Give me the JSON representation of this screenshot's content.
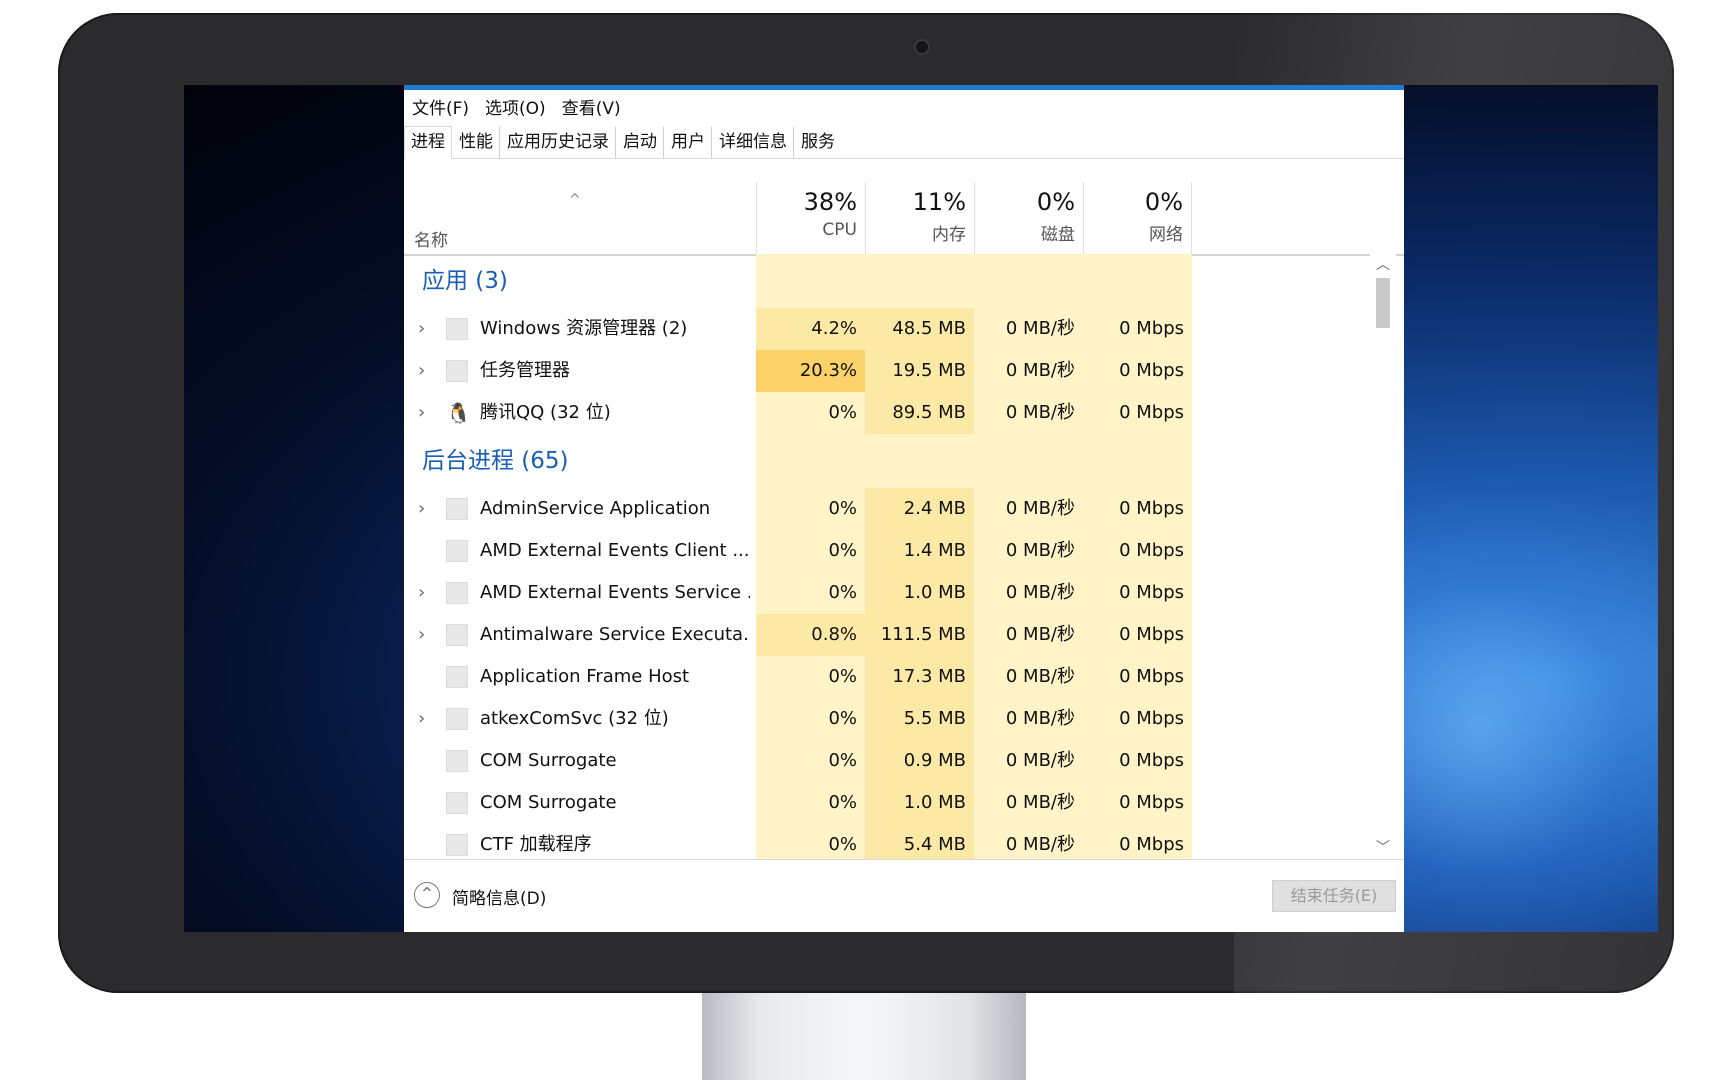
{
  "menu": [
    "文件(F)",
    "选项(O)",
    "查看(V)"
  ],
  "tabs": [
    "进程",
    "性能",
    "应用历史记录",
    "启动",
    "用户",
    "详细信息",
    "服务"
  ],
  "header": {
    "name": "名称",
    "columns": [
      {
        "pct": "38%",
        "label": "CPU"
      },
      {
        "pct": "11%",
        "label": "内存"
      },
      {
        "pct": "0%",
        "label": "磁盘"
      },
      {
        "pct": "0%",
        "label": "网络"
      }
    ]
  },
  "groups": {
    "apps": "应用 (3)",
    "background": "后台进程 (65)"
  },
  "apps": [
    {
      "name": "Windows 资源管理器 (2)",
      "cpu": "4.2%",
      "mem": "48.5 MB",
      "disk": "0 MB/秒",
      "net": "0 Mbps",
      "expand": true,
      "icon": "folder-icon"
    },
    {
      "name": "任务管理器",
      "cpu": "20.3%",
      "mem": "19.5 MB",
      "disk": "0 MB/秒",
      "net": "0 Mbps",
      "expand": true,
      "icon": "taskmgr-icon"
    },
    {
      "name": "腾讯QQ (32 位)",
      "cpu": "0%",
      "mem": "89.5 MB",
      "disk": "0 MB/秒",
      "net": "0 Mbps",
      "expand": true,
      "icon": "qq-penguin-icon"
    }
  ],
  "background": [
    {
      "name": "AdminService Application",
      "cpu": "0%",
      "mem": "2.4 MB",
      "disk": "0 MB/秒",
      "net": "0 Mbps",
      "expand": true
    },
    {
      "name": "AMD External Events Client ...",
      "cpu": "0%",
      "mem": "1.4 MB",
      "disk": "0 MB/秒",
      "net": "0 Mbps",
      "expand": false
    },
    {
      "name": "AMD External Events Service ...",
      "cpu": "0%",
      "mem": "1.0 MB",
      "disk": "0 MB/秒",
      "net": "0 Mbps",
      "expand": true
    },
    {
      "name": "Antimalware Service Executa...",
      "cpu": "0.8%",
      "mem": "111.5 MB",
      "disk": "0 MB/秒",
      "net": "0 Mbps",
      "expand": true
    },
    {
      "name": "Application Frame Host",
      "cpu": "0%",
      "mem": "17.3 MB",
      "disk": "0 MB/秒",
      "net": "0 Mbps",
      "expand": false
    },
    {
      "name": "atkexComSvc (32 位)",
      "cpu": "0%",
      "mem": "5.5 MB",
      "disk": "0 MB/秒",
      "net": "0 Mbps",
      "expand": true
    },
    {
      "name": "COM Surrogate",
      "cpu": "0%",
      "mem": "0.9 MB",
      "disk": "0 MB/秒",
      "net": "0 Mbps",
      "expand": false
    },
    {
      "name": "COM Surrogate",
      "cpu": "0%",
      "mem": "1.0 MB",
      "disk": "0 MB/秒",
      "net": "0 Mbps",
      "expand": false
    },
    {
      "name": "CTF 加载程序",
      "cpu": "0%",
      "mem": "5.4 MB",
      "disk": "0 MB/秒",
      "net": "0 Mbps",
      "expand": false
    }
  ],
  "footer": {
    "collapse_label": "简略信息(D)",
    "end_task": "结束任务(E)"
  },
  "colors": {
    "accent": "#1e7ad3",
    "heat_light": "#fff4c8",
    "heat_mid": "#fde9a6",
    "heat_strong": "#fbd16a",
    "group_text": "#1a5fb4"
  }
}
